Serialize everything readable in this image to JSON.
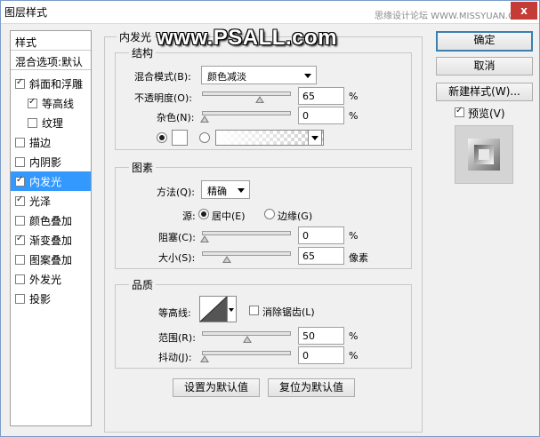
{
  "window": {
    "title": "图层样式",
    "watermark": "思缘设计论坛  WWW.MISSYUAN.COM",
    "close_glyph": "x"
  },
  "overlay_watermark": "www.PSALL.com",
  "styles_panel": {
    "header": "样式",
    "blend_options": "混合选项:默认",
    "items": [
      {
        "label": "斜面和浮雕",
        "checked": true
      },
      {
        "label": "等高线",
        "checked": true
      },
      {
        "label": "纹理",
        "checked": false
      },
      {
        "label": "描边",
        "checked": false
      },
      {
        "label": "内阴影",
        "checked": false
      },
      {
        "label": "内发光",
        "checked": true
      },
      {
        "label": "光泽",
        "checked": true
      },
      {
        "label": "颜色叠加",
        "checked": false
      },
      {
        "label": "渐变叠加",
        "checked": true
      },
      {
        "label": "图案叠加",
        "checked": false
      },
      {
        "label": "外发光",
        "checked": false
      },
      {
        "label": "投影",
        "checked": false
      }
    ]
  },
  "inner_glow": {
    "title": "内发光",
    "structure": {
      "title": "结构",
      "blend_mode_label": "混合模式(B):",
      "blend_mode_value": "颜色减淡",
      "opacity_label": "不透明度(O):",
      "opacity_value": "65",
      "opacity_unit": "%",
      "opacity_fraction": 0.65,
      "noise_label": "杂色(N):",
      "noise_value": "0",
      "noise_unit": "%",
      "noise_fraction": 0.0
    },
    "elements": {
      "title": "图素",
      "technique_label": "方法(Q):",
      "technique_value": "精确",
      "source_label": "源:",
      "source_center": "居中(E)",
      "source_edge": "边缘(G)",
      "choke_label": "阻塞(C):",
      "choke_value": "0",
      "choke_unit": "%",
      "choke_fraction": 0.0,
      "size_label": "大小(S):",
      "size_value": "65",
      "size_unit": "像素",
      "size_fraction": 0.26
    },
    "quality": {
      "title": "品质",
      "contour_label": "等高线:",
      "antialias_label": "消除锯齿(L)",
      "range_label": "范围(R):",
      "range_value": "50",
      "range_unit": "%",
      "range_fraction": 0.5,
      "jitter_label": "抖动(J):",
      "jitter_value": "0",
      "jitter_unit": "%",
      "jitter_fraction": 0.0
    },
    "make_default": "设置为默认值",
    "reset_default": "复位为默认值"
  },
  "buttons": {
    "ok": "确定",
    "cancel": "取消",
    "new_style": "新建样式(W)...",
    "preview": "预览(V)"
  }
}
